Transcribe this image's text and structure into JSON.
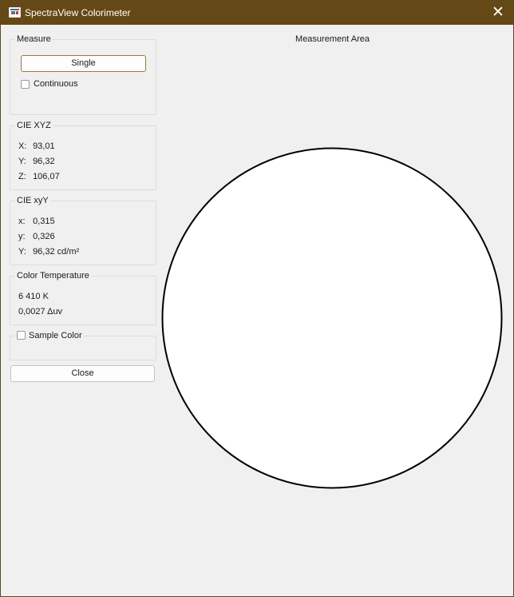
{
  "window": {
    "title": "SpectraView Colorimeter",
    "close_glyph": "✕"
  },
  "measure": {
    "title": "Measure",
    "single_label": "Single",
    "continuous_label": "Continuous",
    "continuous_checked": false
  },
  "cie_xyz": {
    "title": "CIE XYZ",
    "rows": [
      {
        "label": "X:",
        "value": "93,01"
      },
      {
        "label": "Y:",
        "value": "96,32"
      },
      {
        "label": "Z:",
        "value": "106,07"
      }
    ]
  },
  "cie_xyy": {
    "title": "CIE xyY",
    "rows": [
      {
        "label": "x:",
        "value": "0,315"
      },
      {
        "label": "y:",
        "value": "0,326"
      },
      {
        "label": "Y:",
        "value": "96,32 cd/m²"
      }
    ]
  },
  "color_temperature": {
    "title": "Color Temperature",
    "cct": "6 410 K",
    "duv": "0,0027 Δuv"
  },
  "sample_color": {
    "label": "Sample Color",
    "checked": false
  },
  "close_button_label": "Close",
  "measurement_area": {
    "title": "Measurement Area",
    "fill_color": "#ffffff",
    "stroke_color": "#000000"
  },
  "colors": {
    "titlebar": "#664816",
    "accent_border": "#9a7a45",
    "background": "#f0f0f0"
  }
}
